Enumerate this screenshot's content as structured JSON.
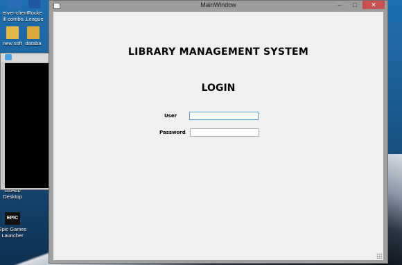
{
  "desktop": {
    "icons": [
      {
        "label": "erver-client\nill combo..."
      },
      {
        "label": "Rocke\nLeague"
      },
      {
        "label": "new soft"
      },
      {
        "label": "databa"
      },
      {
        "label": "GitHub\nDesktop"
      },
      {
        "label": "Epic Games\nLauncher"
      }
    ],
    "epic_logo": "EPIC"
  },
  "window": {
    "title": "MainWindow",
    "minimize": "–",
    "maximize": "□",
    "close": "✕"
  },
  "app": {
    "heading": "LIBRARY MANAGEMENT SYSTEM",
    "subheading": "LOGIN",
    "user_label": "User",
    "user_value": "",
    "password_label": "Password",
    "password_value": ""
  }
}
